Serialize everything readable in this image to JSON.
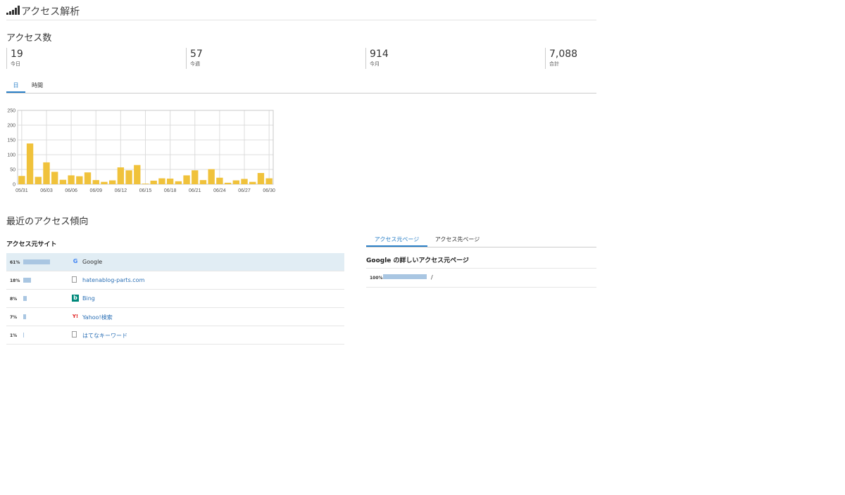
{
  "header": {
    "title": "アクセス解析"
  },
  "access_count": {
    "title": "アクセス数",
    "stats": [
      {
        "value": "19",
        "label": "今日"
      },
      {
        "value": "57",
        "label": "今週"
      },
      {
        "value": "914",
        "label": "今月"
      },
      {
        "value": "7,088",
        "label": "合計"
      }
    ]
  },
  "period_tabs": [
    {
      "label": "日",
      "active": true
    },
    {
      "label": "時間",
      "active": false
    }
  ],
  "chart_data": {
    "type": "bar",
    "categories": [
      "05/31",
      "06/01",
      "06/02",
      "06/03",
      "06/04",
      "06/05",
      "06/06",
      "06/07",
      "06/08",
      "06/09",
      "06/10",
      "06/11",
      "06/12",
      "06/13",
      "06/14",
      "06/15",
      "06/16",
      "06/17",
      "06/18",
      "06/19",
      "06/20",
      "06/21",
      "06/22",
      "06/23",
      "06/24",
      "06/25",
      "06/26",
      "06/27",
      "06/28",
      "06/29",
      "06/30"
    ],
    "values": [
      28,
      138,
      25,
      74,
      42,
      15,
      30,
      27,
      40,
      14,
      8,
      13,
      57,
      47,
      65,
      2,
      12,
      20,
      19,
      10,
      30,
      47,
      14,
      51,
      22,
      5,
      13,
      18,
      8,
      38,
      20
    ],
    "tick_labels": [
      "05/31",
      "06/03",
      "06/06",
      "06/09",
      "06/12",
      "06/15",
      "06/18",
      "06/21",
      "06/24",
      "06/27",
      "06/30"
    ],
    "ylim": [
      0,
      250
    ],
    "yticks": [
      0,
      50,
      100,
      150,
      200,
      250
    ],
    "grid": true,
    "bar_color": "#f0c23b"
  },
  "trend": {
    "title": "最近のアクセス傾向"
  },
  "sources": {
    "title": "アクセス元サイト",
    "items": [
      {
        "pct": "61%",
        "share": 61,
        "name": "Google",
        "icon": "google-icon",
        "selected": true
      },
      {
        "pct": "18%",
        "share": 18,
        "name": "hatenablog-parts.com",
        "icon": "page-icon",
        "selected": false
      },
      {
        "pct": "8%",
        "share": 8,
        "name": "Bing",
        "icon": "bing-icon",
        "selected": false
      },
      {
        "pct": "7%",
        "share": 7,
        "name": "Yahoo!検索",
        "icon": "yahoo-icon",
        "selected": false
      },
      {
        "pct": "1%",
        "share": 1,
        "name": "はてなキーワード",
        "icon": "page-icon",
        "selected": false
      }
    ]
  },
  "page_tabs": [
    {
      "label": "アクセス元ページ",
      "active": true
    },
    {
      "label": "アクセス先ページ",
      "active": false
    }
  ],
  "detail": {
    "title": "Google の詳しいアクセス元ページ",
    "rows": [
      {
        "pct": "100%",
        "share": 100,
        "path": "/"
      }
    ]
  },
  "colors": {
    "accent": "#2a7fc7",
    "bar_fill": "#a9c6e2",
    "selected_row": "#e1edf4"
  }
}
